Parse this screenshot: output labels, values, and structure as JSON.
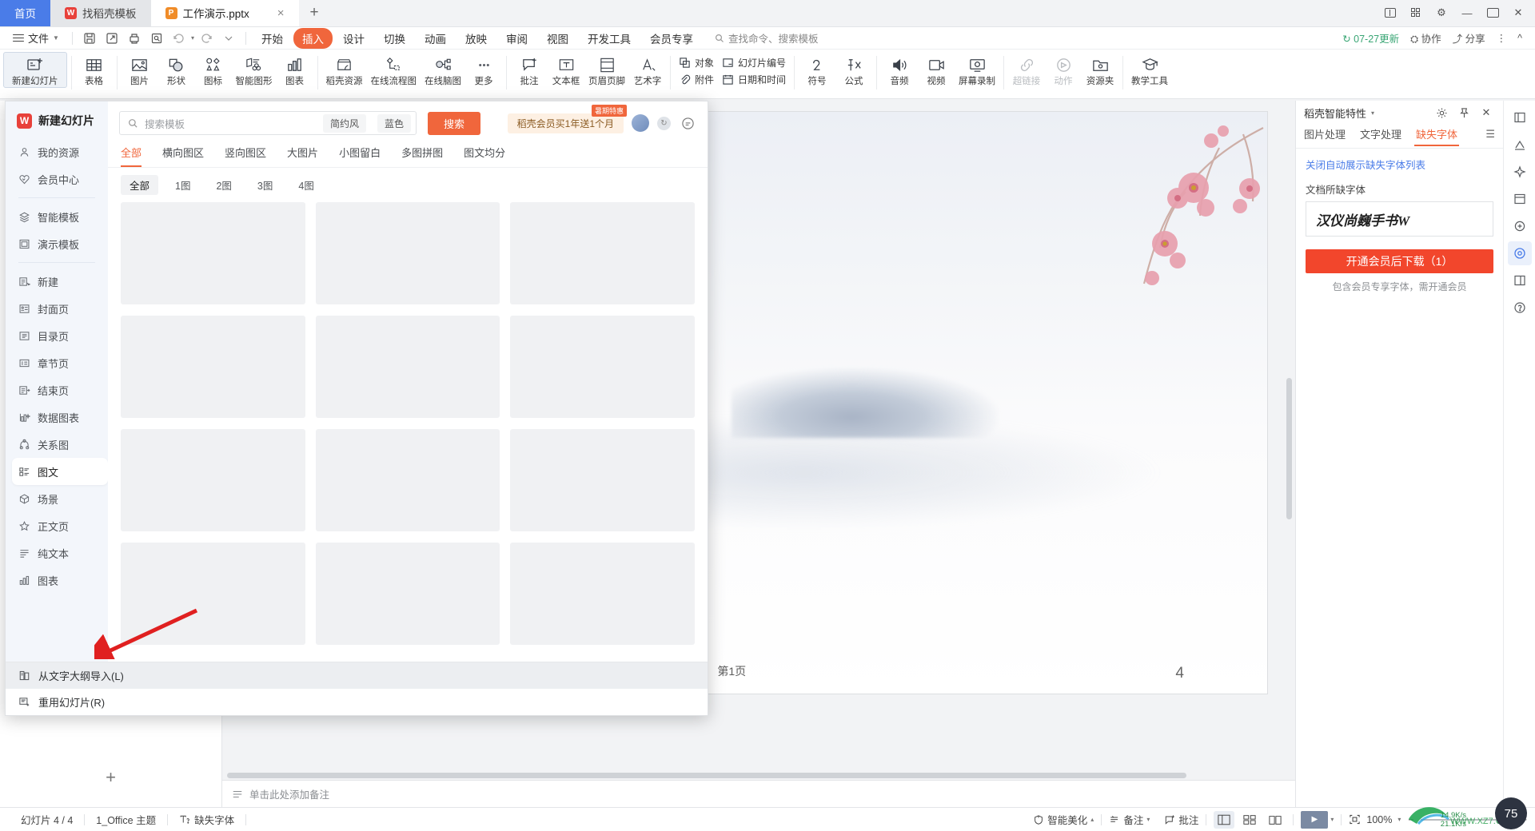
{
  "window": {
    "tabs": [
      {
        "label": "首页",
        "type": "home"
      },
      {
        "label": "找稻壳模板",
        "type": "inactive",
        "icon": "wps-logo-icon"
      },
      {
        "label": "工作演示.pptx",
        "type": "active",
        "icon": "powerpoint-icon"
      }
    ],
    "new_tab": "+",
    "controls": [
      "minimize",
      "maximize",
      "close"
    ]
  },
  "menubar": {
    "file_label": "文件",
    "quick_actions": [
      "save-icon",
      "save-as-icon",
      "print-icon",
      "print-preview-icon",
      "undo-icon",
      "redo-icon",
      "customize-icon"
    ],
    "tabs": [
      {
        "label": "开始",
        "selected": false
      },
      {
        "label": "插入",
        "selected": true
      },
      {
        "label": "设计",
        "selected": false
      },
      {
        "label": "切换",
        "selected": false
      },
      {
        "label": "动画",
        "selected": false
      },
      {
        "label": "放映",
        "selected": false
      },
      {
        "label": "审阅",
        "selected": false
      },
      {
        "label": "视图",
        "selected": false
      },
      {
        "label": "开发工具",
        "selected": false
      },
      {
        "label": "会员专享",
        "selected": false
      }
    ],
    "find_placeholder": "查找命令、搜索模板",
    "right_items": [
      {
        "label": "07-27更新",
        "icon": "refresh-icon"
      },
      {
        "label": "协作",
        "icon": "collab-icon"
      },
      {
        "label": "分享",
        "icon": "share-icon"
      },
      {
        "label": "",
        "icon": "more-icon"
      },
      {
        "label": "",
        "icon": "collapse-ribbon-icon"
      }
    ]
  },
  "ribbon": {
    "buttons": [
      {
        "label": "新建幻灯片",
        "icon": "new-slide-icon",
        "dropdown": true,
        "active": true
      },
      {
        "label": "表格",
        "icon": "table-icon",
        "dropdown": true
      },
      {
        "label": "图片",
        "icon": "picture-icon",
        "dropdown": true
      },
      {
        "label": "形状",
        "icon": "shapes-icon",
        "dropdown": true
      },
      {
        "label": "图标",
        "icon": "icons-icon",
        "dropdown": true
      },
      {
        "label": "智能图形",
        "icon": "smartart-icon",
        "dropdown": false
      },
      {
        "label": "图表",
        "icon": "chart-icon",
        "dropdown": false
      },
      {
        "label": "稻壳资源",
        "icon": "docer-resource-icon",
        "dropdown": false
      },
      {
        "label": "在线流程图",
        "icon": "flowchart-icon",
        "dropdown": false
      },
      {
        "label": "在线脑图",
        "icon": "mindmap-icon",
        "dropdown": false
      },
      {
        "label": "更多",
        "icon": "more-dots-icon",
        "dropdown": true
      },
      {
        "label": "批注",
        "icon": "comment-icon",
        "dropdown": false
      },
      {
        "label": "文本框",
        "icon": "textbox-icon",
        "dropdown": true
      },
      {
        "label": "页眉页脚",
        "icon": "header-footer-icon",
        "dropdown": false
      },
      {
        "label": "艺术字",
        "icon": "wordart-icon",
        "dropdown": true
      }
    ],
    "stacked": [
      {
        "top": "对象",
        "top_icon": "object-icon",
        "bottom": "附件",
        "bottom_icon": "attachment-icon"
      },
      {
        "top": "幻灯片编号",
        "top_icon": "slide-number-icon",
        "bottom": "日期和时间",
        "bottom_icon": "date-time-icon"
      }
    ],
    "buttons2": [
      {
        "label": "符号",
        "icon": "symbol-icon",
        "dropdown": true
      },
      {
        "label": "公式",
        "icon": "formula-icon",
        "dropdown": true
      },
      {
        "label": "音频",
        "icon": "audio-icon",
        "dropdown": true
      },
      {
        "label": "视频",
        "icon": "video-icon",
        "dropdown": true
      },
      {
        "label": "屏幕录制",
        "icon": "screen-record-icon",
        "dropdown": false
      },
      {
        "label": "超链接",
        "icon": "hyperlink-icon",
        "dropdown": true,
        "disabled": true
      },
      {
        "label": "动作",
        "icon": "action-icon",
        "dropdown": false,
        "disabled": true
      },
      {
        "label": "资源夹",
        "icon": "resource-folder-icon",
        "dropdown": false
      },
      {
        "label": "教学工具",
        "icon": "teaching-tools-icon",
        "dropdown": false
      }
    ]
  },
  "dropdown": {
    "sidebar": {
      "brand": "新建幻灯片",
      "items": [
        {
          "label": "我的资源",
          "icon": "user-icon"
        },
        {
          "label": "会员中心",
          "icon": "vip-heart-icon"
        },
        {
          "divider": true
        },
        {
          "label": "智能模板",
          "icon": "smart-template-icon"
        },
        {
          "label": "演示模板",
          "icon": "presentation-template-icon"
        },
        {
          "divider": true
        },
        {
          "label": "新建",
          "icon": "new-page-icon"
        },
        {
          "label": "封面页",
          "icon": "cover-page-icon"
        },
        {
          "label": "目录页",
          "icon": "toc-page-icon"
        },
        {
          "label": "章节页",
          "icon": "chapter-page-icon"
        },
        {
          "label": "结束页",
          "icon": "end-page-icon"
        },
        {
          "label": "数据图表",
          "icon": "data-chart-icon"
        },
        {
          "label": "关系图",
          "icon": "relation-diagram-icon"
        },
        {
          "label": "图文",
          "icon": "image-text-icon",
          "selected": true
        },
        {
          "label": "场景",
          "icon": "scene-icon"
        },
        {
          "label": "正文页",
          "icon": "body-page-icon"
        },
        {
          "label": "纯文本",
          "icon": "plain-text-icon"
        },
        {
          "label": "图表",
          "icon": "bar-chart-icon"
        }
      ]
    },
    "search": {
      "placeholder": "搜索模板",
      "chips": [
        "简约风",
        "蓝色"
      ],
      "button": "搜索"
    },
    "promo": {
      "tag": "暑期特惠",
      "text": "稻壳会员买1年送1个月"
    },
    "filters": [
      {
        "label": "全部",
        "on": true
      },
      {
        "label": "横向图区",
        "on": false
      },
      {
        "label": "竖向图区",
        "on": false
      },
      {
        "label": "大图片",
        "on": false
      },
      {
        "label": "小图留白",
        "on": false
      },
      {
        "label": "多图拼图",
        "on": false
      },
      {
        "label": "图文均分",
        "on": false
      }
    ],
    "subfilters": [
      {
        "label": "全部",
        "on": true
      },
      {
        "label": "1图",
        "on": false
      },
      {
        "label": "2图",
        "on": false
      },
      {
        "label": "3图",
        "on": false
      },
      {
        "label": "4图",
        "on": false
      }
    ],
    "card_count": 12,
    "footer_items": [
      {
        "label": "从文字大纲导入(L)",
        "icon": "import-outline-icon",
        "hover": true
      },
      {
        "label": "重用幻灯片(R)",
        "icon": "reuse-slide-icon",
        "hover": false
      }
    ]
  },
  "taskpane": {
    "title": "稻壳智能特性",
    "header_icons": [
      "gear-icon",
      "pin-icon",
      "close-icon"
    ],
    "tabs": [
      {
        "label": "图片处理",
        "on": false
      },
      {
        "label": "文字处理",
        "on": false
      },
      {
        "label": "缺失字体",
        "on": true
      }
    ],
    "menu_icon": "hamburger-icon",
    "link": "关闭自动展示缺失字体列表",
    "section_label": "文档所缺字体",
    "font_name": "汉仪尚巍手书W",
    "cta": "开通会员后下载（1）",
    "note": "包含会员专享字体，需开通会员"
  },
  "rail_icons": [
    "sidebar-collapse-icon",
    "design-ideas-icon",
    "ai-sparkle-icon",
    "template-icon",
    "docer-icon",
    "smart-feature-icon",
    "resource-icon",
    "help-icon"
  ],
  "slide": {
    "page_label": "第1页",
    "page_number": "4"
  },
  "notes": {
    "placeholder": "单击此处添加备注",
    "icon": "notes-icon"
  },
  "statusbar": {
    "left": [
      {
        "label": "幻灯片 4 / 4"
      },
      {
        "label": "1_Office 主题"
      },
      {
        "label": "缺失字体",
        "icon": "missing-font-icon"
      }
    ],
    "right": [
      {
        "label": "智能美化",
        "icon": "beautify-icon",
        "caret": true
      },
      {
        "label": "备注",
        "icon": "notes-icon",
        "caret": true
      },
      {
        "label": "批注",
        "icon": "comment-icon",
        "caret": false
      }
    ],
    "views": [
      {
        "name": "normal-view",
        "on": true
      },
      {
        "name": "slide-sorter-view",
        "on": false
      },
      {
        "name": "reading-view",
        "on": false
      }
    ],
    "play_label": "▶",
    "fit_icon": "fit-slide-icon",
    "zoom": "100%",
    "zoom_minus": "−",
    "zoom_plus": "+"
  },
  "overlay": {
    "net_down": "14.9K/s",
    "net_up": "21.1K/s",
    "gauge": "75"
  },
  "colors": {
    "accent_orange": "#f0663c",
    "accent_blue": "#4a7ce8",
    "cta_red": "#f2462c",
    "sidebar_bg": "#f3f6fb",
    "arrow_red": "#e02020"
  }
}
